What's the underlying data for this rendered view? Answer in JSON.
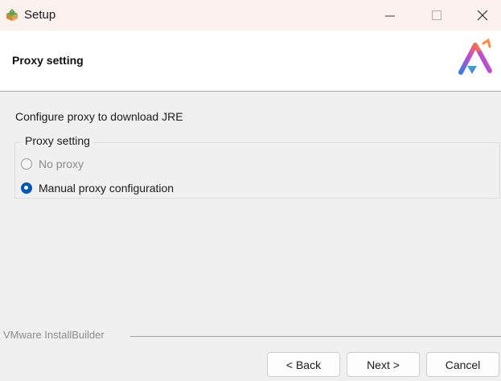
{
  "window": {
    "title": "Setup",
    "icon": "setup-app-icon",
    "controls": {
      "minimize": "minimize-icon",
      "maximize": "maximize-icon",
      "close": "close-icon"
    }
  },
  "header": {
    "title": "Proxy setting",
    "logo": "installer-logo",
    "background": "#ffffff"
  },
  "content": {
    "description": "Configure proxy to download JRE",
    "group_label": "Proxy setting",
    "options": [
      {
        "label": "No proxy",
        "selected": false,
        "enabled": false
      },
      {
        "label": "Manual proxy configuration",
        "selected": true,
        "enabled": true
      }
    ]
  },
  "footer": {
    "brand": "VMware InstallBuilder",
    "back_label": "< Back",
    "next_label": "Next >",
    "cancel_label": "Cancel"
  },
  "colors": {
    "titlebar": "#fbf2ef",
    "window_bg": "#f0f0f0",
    "radio_accent": "#0059b8"
  }
}
